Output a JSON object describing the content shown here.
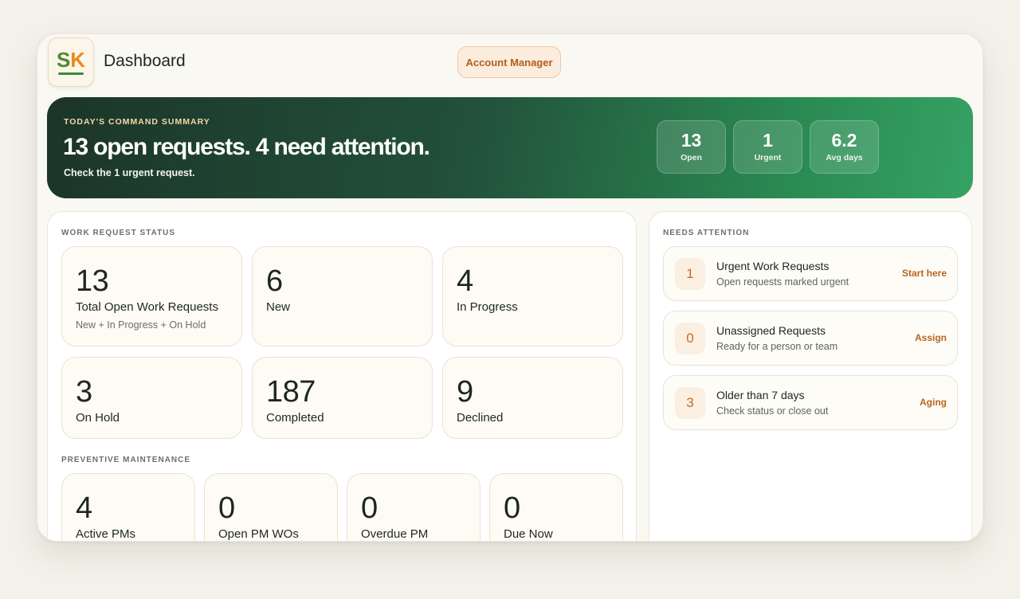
{
  "header": {
    "logo": {
      "s": "S",
      "k": "K"
    },
    "title": "Dashboard",
    "account_button": "Account Manager"
  },
  "banner": {
    "eyebrow": "TODAY'S COMMAND SUMMARY",
    "headline": "13 open requests. 4 need attention.",
    "subtext": "Check the 1 urgent request.",
    "stats": [
      {
        "value": "13",
        "label": "Open"
      },
      {
        "value": "1",
        "label": "Urgent"
      },
      {
        "value": "6.2",
        "label": "Avg days"
      }
    ]
  },
  "work_request_status": {
    "label": "WORK REQUEST STATUS",
    "cards": [
      {
        "value": "13",
        "label": "Total Open Work Requests",
        "note": "New + In Progress + On Hold"
      },
      {
        "value": "6",
        "label": "New"
      },
      {
        "value": "4",
        "label": "In Progress"
      },
      {
        "value": "3",
        "label": "On Hold"
      },
      {
        "value": "187",
        "label": "Completed"
      },
      {
        "value": "9",
        "label": "Declined"
      }
    ]
  },
  "preventive_maintenance": {
    "label": "PREVENTIVE MAINTENANCE",
    "cards": [
      {
        "value": "4",
        "label": "Active PMs"
      },
      {
        "value": "0",
        "label": "Open PM WOs"
      },
      {
        "value": "0",
        "label": "Overdue PM"
      },
      {
        "value": "0",
        "label": "Due Now"
      }
    ]
  },
  "needs_attention": {
    "label": "NEEDS ATTENTION",
    "items": [
      {
        "count": "1",
        "title": "Urgent Work Requests",
        "description": "Open requests marked urgent",
        "action": "Start here"
      },
      {
        "count": "0",
        "title": "Unassigned Requests",
        "description": "Ready for a person or team",
        "action": "Assign"
      },
      {
        "count": "3",
        "title": "Older than 7 days",
        "description": "Check status or close out",
        "action": "Aging"
      }
    ]
  },
  "colors": {
    "accent_orange": "#b8651f",
    "banner_dark": "#1c3529",
    "banner_light": "#35a263",
    "page_bg": "#f4f1ea"
  }
}
